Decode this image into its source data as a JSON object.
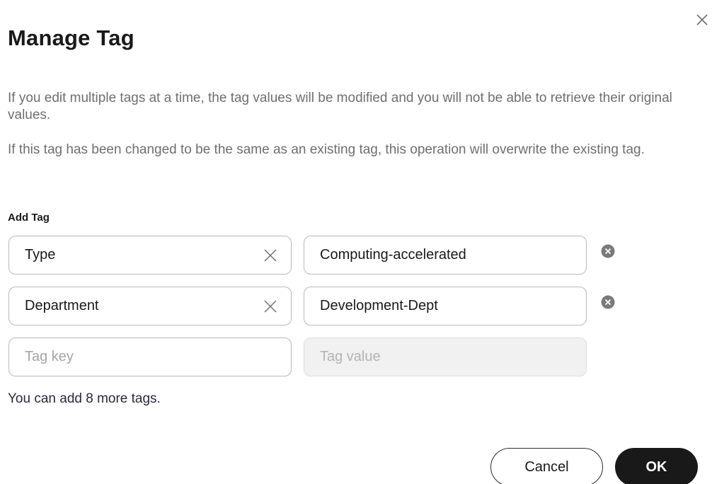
{
  "dialog": {
    "title": "Manage Tag",
    "notices": [
      "If you edit multiple tags at a time, the tag values will be modified and you will not be able to retrieve their original values.",
      "If this tag has been changed to be the same as an existing tag, this operation will overwrite the existing tag."
    ],
    "section_label": "Add Tag",
    "tags": [
      {
        "key": "Type",
        "value": "Computing-accelerated"
      },
      {
        "key": "Department",
        "value": "Development-Dept"
      }
    ],
    "new_tag": {
      "key_placeholder": "Tag key",
      "value_placeholder": "Tag value"
    },
    "hint": "You can add 8 more tags.",
    "cancel_label": "Cancel",
    "ok_label": "OK"
  },
  "icons": {
    "close": "close-icon",
    "clear": "clear-x-icon",
    "remove": "remove-circle-icon"
  },
  "colors": {
    "primary_button": "#191919",
    "muted_text": "#6f6f6f",
    "border": "#b9b9b9",
    "disabled_bg": "#f1f1f1",
    "remove_icon": "#7a7a7a"
  }
}
